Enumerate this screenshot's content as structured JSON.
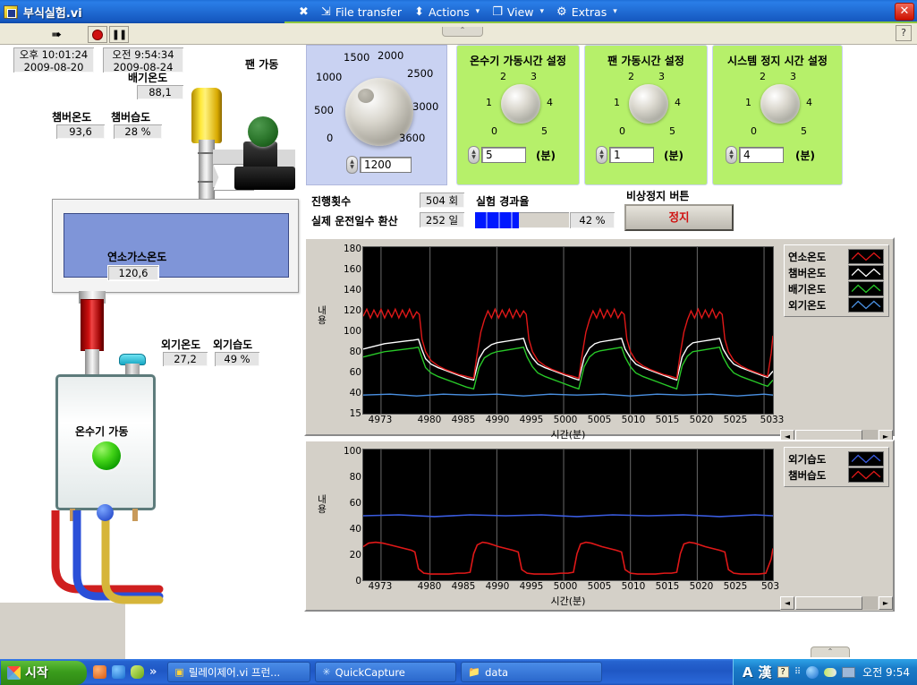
{
  "window": {
    "title": "부식실험.vi",
    "close_label": "✕"
  },
  "toolbar_menu": {
    "items": [
      {
        "icon": "close-x-icon",
        "glyph": "✖",
        "label": "",
        "caret": false
      },
      {
        "icon": "file-transfer-icon",
        "glyph": "⇲",
        "label": "File transfer",
        "caret": false
      },
      {
        "icon": "actions-icon",
        "glyph": "⬍",
        "label": "Actions",
        "caret": true
      },
      {
        "icon": "view-icon",
        "glyph": "❐",
        "label": "View",
        "caret": true
      },
      {
        "icon": "gear-icon",
        "glyph": "⚙",
        "label": "Extras",
        "caret": true
      }
    ],
    "caret": "▾"
  },
  "vi_toolbar": {
    "run_glyph": "➠",
    "stop_title": "stop",
    "pause_glyph": "❚❚",
    "help_glyph": "?",
    "collapse_glyph": "⌃"
  },
  "readouts": {
    "time_pm": {
      "time": "오후 10:01:24",
      "date": "2009-08-20"
    },
    "time_am": {
      "time": "오전 9:54:34",
      "date": "2009-08-24"
    },
    "exhaust_temp": {
      "label": "배기온도",
      "value": "88,1"
    },
    "chamber_temp": {
      "label": "챔버온도",
      "value": "93,6"
    },
    "chamber_humid": {
      "label": "챔버습도",
      "value": "28 %"
    },
    "flue_gas_temp": {
      "label": "연소가스온도",
      "value": "120,6"
    },
    "outdoor_temp": {
      "label": "외기온도",
      "value": "27,2"
    },
    "outdoor_humid": {
      "label": "외기습도",
      "value": "49 %"
    },
    "fan_running": {
      "label": "팬 가동"
    },
    "heater_running": {
      "label": "온수기 가동"
    }
  },
  "rpm_dial": {
    "ticks": [
      "0",
      "500",
      "1000",
      "1500",
      "2000",
      "2500",
      "3000",
      "3600"
    ],
    "value": "1200"
  },
  "green_panels": [
    {
      "name": "water-heater-runtime",
      "title": "온수기 가동시간 설정",
      "ticks": [
        "0",
        "1",
        "2",
        "3",
        "4",
        "5"
      ],
      "value": "5",
      "unit": "(분)"
    },
    {
      "name": "fan-runtime",
      "title": "팬 가동시간 설정",
      "ticks": [
        "0",
        "1",
        "2",
        "3",
        "4",
        "5"
      ],
      "value": "1",
      "unit": "(분)"
    },
    {
      "name": "system-stop-time",
      "title": "시스템 정지 시간 설정",
      "ticks": [
        "0",
        "1",
        "2",
        "3",
        "4",
        "5"
      ],
      "value": "4",
      "unit": "(분)"
    }
  ],
  "status": {
    "cycle_label": "진행횟수",
    "cycle_value": "504 회",
    "days_label": "실제 운전일수 환산",
    "days_value": "252 일",
    "progress_label": "실험 경과율",
    "progress_value": "42 %",
    "progress_percent": 42,
    "estop_label": "비상정지 버튼",
    "estop_button": "정지"
  },
  "chart_data": [
    {
      "name": "temperature-chart",
      "type": "line",
      "title": "",
      "xlabel": "시간(분)",
      "ylabel": "내용",
      "xticks": [
        "4973",
        "4980",
        "4985",
        "4990",
        "4995",
        "5000",
        "5005",
        "5010",
        "5015",
        "5020",
        "5025",
        "5033"
      ],
      "yticks": [
        "180",
        "160",
        "140",
        "120",
        "100",
        "80",
        "60",
        "40",
        "15"
      ],
      "ylim": [
        15,
        180
      ],
      "xlim": [
        4973,
        5033
      ],
      "grid": true,
      "legend_position": "right",
      "series": [
        {
          "name": "연소온도",
          "color": "#e01818",
          "description": "Combustion temperature — repeating sawtooth cycles peaking near 120 with serrated tops, dropping to ~60-65 between cycles",
          "peak": 122,
          "trough": 60
        },
        {
          "name": "챔버온도",
          "color": "#ffffff",
          "description": "Chamber temperature — plateaus near 95-100, falls to ~62 during off periods",
          "peak": 100,
          "trough": 62
        },
        {
          "name": "배기온도",
          "color": "#28c828",
          "description": "Exhaust temperature — plateaus near 88-92, falls to ~52 during off periods",
          "peak": 92,
          "trough": 52
        },
        {
          "name": "외기온도",
          "color": "#4a90e2",
          "description": "Outdoor temperature — nearly flat line around 27",
          "peak": 29,
          "trough": 26
        }
      ]
    },
    {
      "name": "humidity-chart",
      "type": "line",
      "title": "",
      "xlabel": "시간(분)",
      "ylabel": "내용",
      "xticks": [
        "4973",
        "4980",
        "4985",
        "4990",
        "4995",
        "5000",
        "5005",
        "5010",
        "5015",
        "5020",
        "5025",
        "503"
      ],
      "yticks": [
        "100",
        "80",
        "60",
        "40",
        "20",
        "0"
      ],
      "ylim": [
        0,
        100
      ],
      "xlim": [
        4973,
        5033
      ],
      "grid": true,
      "legend_position": "right",
      "series": [
        {
          "name": "외기습도",
          "color": "#3a5ce0",
          "description": "Outdoor humidity — nearly flat line around 48-50",
          "peak": 51,
          "trough": 47
        },
        {
          "name": "챔버습도",
          "color": "#e01818",
          "description": "Chamber humidity — square-wave cycles, high plateau near 28-30, dropping to ~5 during heating",
          "peak": 31,
          "trough": 5
        }
      ]
    }
  ],
  "scrollbars": {
    "left_arrow": "◄",
    "right_arrow": "►"
  },
  "taskbar": {
    "start_label": "시작",
    "quick_launch": [
      {
        "name": "browser-icon",
        "color": "#e87722"
      },
      {
        "name": "ie-icon",
        "color": "#2a7ee8"
      },
      {
        "name": "pen-icon",
        "color": "#9ad22a"
      },
      {
        "name": "more-chevron-icon",
        "color": "transparent",
        "glyph": "»"
      }
    ],
    "tasks": [
      {
        "name": "labview-task",
        "icon_glyph": "▣",
        "label": "릴레이제어.vi 프런..."
      },
      {
        "name": "quickcapture-task",
        "icon_glyph": "✳",
        "label": "QuickCapture"
      },
      {
        "name": "data-folder-task",
        "icon_glyph": "📁",
        "label": "data"
      }
    ],
    "tray": {
      "ime_a": "A",
      "ime_han": "漢",
      "ime_box": "?",
      "ime_dots": "⠿",
      "icons": [
        "back-icon",
        "pill-icon",
        "monitor-icon"
      ],
      "clock": "오전 9:54"
    }
  }
}
